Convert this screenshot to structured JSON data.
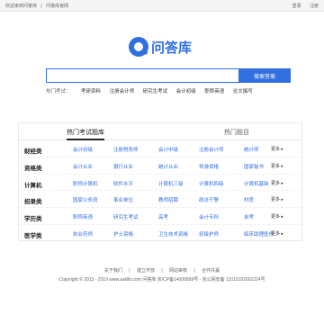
{
  "topbar": {
    "welcome": "欢迎来到问答库",
    "divider": "|",
    "site_name": "问答库官网",
    "login": "登录",
    "register": "注册"
  },
  "logo": {
    "text": "问答库",
    "color": "#2f6fe0"
  },
  "search": {
    "value": "",
    "placeholder": "",
    "button_label": "搜索答案"
  },
  "hot": {
    "label": "热门考试：",
    "items": [
      "考研资料",
      "注册会计师",
      "研究生考试",
      "会计初级",
      "职称英语",
      "论文撰写"
    ]
  },
  "tabs": {
    "active": "热门考试题库",
    "inactive": "热门题目"
  },
  "categories": [
    {
      "name": "财经类",
      "items": [
        "会计初级",
        "注册税务师",
        "会计中级",
        "注册会计师",
        "统计师"
      ],
      "more": "更多"
    },
    {
      "name": "资格类",
      "items": [
        "会计从业",
        "银行从业",
        "统计从业",
        "导游资格",
        "国家秘书"
      ],
      "more": "更多"
    },
    {
      "name": "计算机",
      "items": [
        "职称计算机",
        "软件水平",
        "计算机三级",
        "计算机四级",
        "计算机基础"
      ],
      "more": "更多"
    },
    {
      "name": "招录类",
      "items": [
        "国家公务员",
        "事业单位",
        "教师招聘",
        "政法干警",
        "村官"
      ],
      "more": "更多"
    },
    {
      "name": "学历类",
      "items": [
        "职称英语",
        "研究生考试",
        "高考",
        "会计专科",
        "自考"
      ],
      "more": "更多"
    },
    {
      "name": "医学类",
      "items": [
        "执业药师",
        "护士资格",
        "卫生技术资格",
        "初级护师",
        "临床助理医师"
      ],
      "more": "更多"
    }
  ],
  "footer": {
    "links": [
      "关于我们",
      "|",
      "建立开放",
      "|",
      "网站审核",
      "|",
      "合作共赢"
    ],
    "copyright": "Copyright © 2013 - 2019 www.askllb.com 问答库   京ICP备14006899号 - 京公网安备 11010102001224号"
  },
  "colors": {
    "accent": "#2f6fe0"
  }
}
